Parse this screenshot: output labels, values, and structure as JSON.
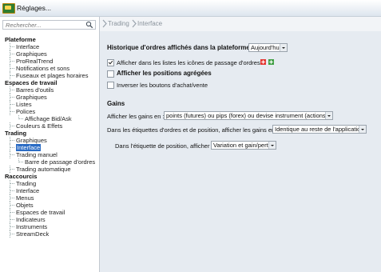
{
  "window": {
    "title": "Réglages..."
  },
  "search": {
    "placeholder": "Rechercher..."
  },
  "tree": [
    {
      "label": "Plateforme",
      "level": 0
    },
    {
      "label": "Interface",
      "level": 1
    },
    {
      "label": "Graphiques",
      "level": 1
    },
    {
      "label": "ProRealTrend",
      "level": 1
    },
    {
      "label": "Notifications et sons",
      "level": 1
    },
    {
      "label": "Fuseaux et plages horaires",
      "level": 1
    },
    {
      "label": "Espaces de travail",
      "level": 0
    },
    {
      "label": "Barres d'outils",
      "level": 1
    },
    {
      "label": "Graphiques",
      "level": 1
    },
    {
      "label": "Listes",
      "level": 1
    },
    {
      "label": "Polices",
      "level": 1
    },
    {
      "label": "Affichage Bid/Ask",
      "level": 2
    },
    {
      "label": "Couleurs & Effets",
      "level": 1
    },
    {
      "label": "Trading",
      "level": 0
    },
    {
      "label": "Graphiques",
      "level": 1
    },
    {
      "label": "Interface",
      "level": 1,
      "selected": true
    },
    {
      "label": "Trading manuel",
      "level": 1
    },
    {
      "label": "Barre de passage d'ordres",
      "level": 2
    },
    {
      "label": "Trading automatique",
      "level": 1
    },
    {
      "label": "Raccourcis",
      "level": 0
    },
    {
      "label": "Trading",
      "level": 1
    },
    {
      "label": "Interface",
      "level": 1
    },
    {
      "label": "Menus",
      "level": 1
    },
    {
      "label": "Objets",
      "level": 1
    },
    {
      "label": "Espaces de travail",
      "level": 1
    },
    {
      "label": "Indicateurs",
      "level": 1
    },
    {
      "label": "Instruments",
      "level": 1
    },
    {
      "label": "StreamDeck",
      "level": 1
    }
  ],
  "breadcrumb": {
    "item1": "Trading",
    "item2": "Interface"
  },
  "settings": {
    "history_label": "Historique d'ordres affichés dans la plateforme :",
    "history_value": "Aujourd'hui",
    "show_icons_label": "Afficher dans les listes les icônes de passage d'ordres",
    "show_icons_checked": true,
    "aggregated_label": "Afficher les positions agrégées",
    "aggregated_checked": false,
    "invert_label": "Inverser les boutons d'achat/vente",
    "invert_checked": false
  },
  "gains": {
    "section_title": "Gains",
    "display_label": "Afficher les gains en :",
    "display_value": "points (futures) ou pips (forex) ou devise instrument (actions)",
    "labels_label": "Dans les étiquettes d'ordres et de position, afficher les gains en :",
    "labels_value": "Identique au reste de l'application",
    "position_label": "Dans l'étiquette de position, afficher :",
    "position_value": "Variation et gain/perte"
  },
  "colors": {
    "selected": "#2b6cc4",
    "panel": "#e6ebf1"
  }
}
